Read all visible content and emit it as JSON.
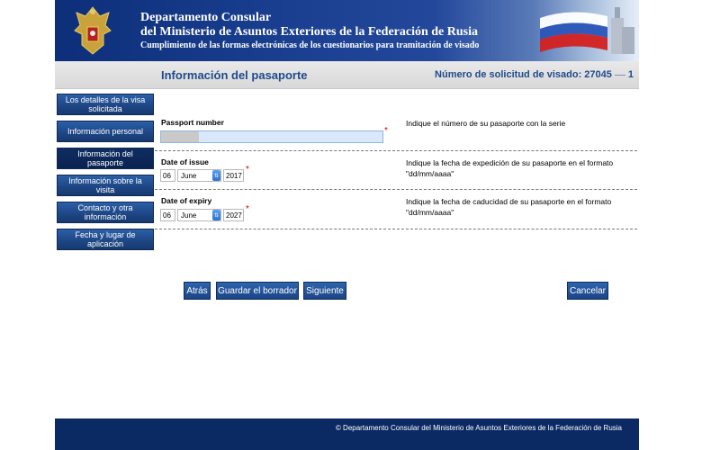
{
  "header": {
    "title_line1": "Departamento Consular",
    "title_line2": "del Ministerio de Asuntos Exteriores de la Federación de Rusia",
    "subtitle": "Cumplimiento de las formas electrónicas de los cuestionarios para tramitación de visado",
    "colors": {
      "banner": "#1a3f90",
      "footer": "#0b2a63",
      "accent": "#1f4a8c"
    }
  },
  "subheader": {
    "page_title": "Información del pasaporte",
    "app_number_label": "Número de solicitud de visado: 27045",
    "app_number_suffix": "1"
  },
  "sidebar": {
    "items": [
      {
        "label": "Los detalles de la visa solicitada",
        "active": false
      },
      {
        "label": "Información personal",
        "active": false
      },
      {
        "label": "Información del pasaporte",
        "active": true
      },
      {
        "label": "Información sobre la visita",
        "active": false
      },
      {
        "label": "Contacto y otra información",
        "active": false
      },
      {
        "label": "Fecha y lugar de aplicación",
        "active": false
      }
    ]
  },
  "form": {
    "passport": {
      "label": "Passport number",
      "value": "",
      "required_mark": "*",
      "hint": "Indique el número de su pasaporte con la serie"
    },
    "issue": {
      "label": "Date of issue",
      "day": "06",
      "month": "June",
      "year": "2017",
      "required_mark": "*",
      "hint": "Indique la fecha de expedición de su pasaporte en el formato \"dd/mm/aaaa\""
    },
    "expiry": {
      "label": "Date of expiry",
      "day": "06",
      "month": "June",
      "year": "2027",
      "required_mark": "*",
      "hint": "Indique la fecha de caducidad de su pasaporte en el formato \"dd/mm/aaaa\""
    }
  },
  "actions": {
    "back": "Atrás",
    "save_draft": "Guardar el borrador",
    "next": "Siguiente",
    "cancel": "Cancelar"
  },
  "footer": {
    "text": "© Departamento Consular del Ministerio de Asuntos Exteriores de la Federación de Rusia"
  },
  "icons": {
    "emblem": "russian-coat-of-arms-icon",
    "flag": "russian-flag-icon",
    "spinner": "up-down-arrows-icon"
  }
}
